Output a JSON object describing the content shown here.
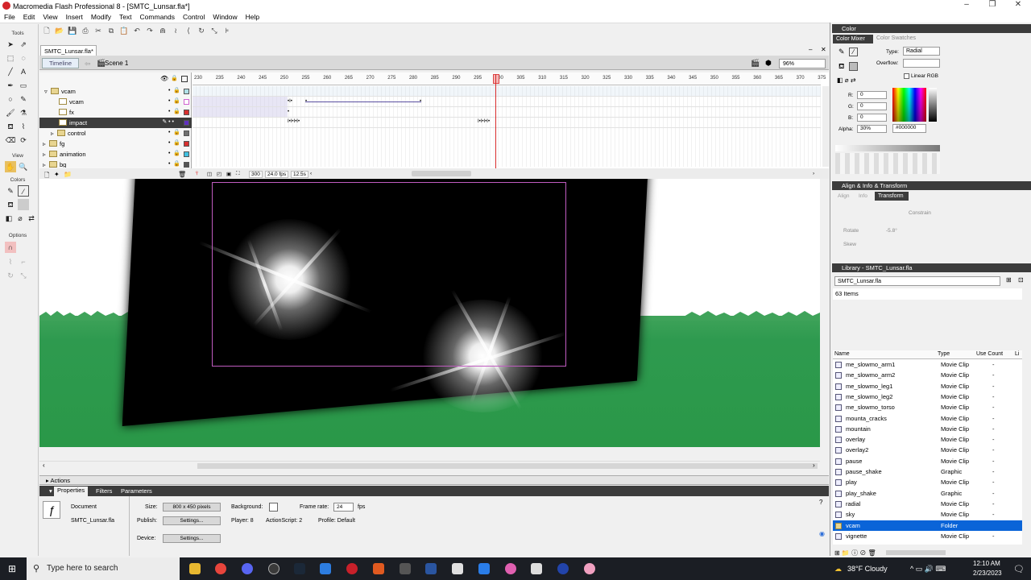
{
  "window": {
    "title": "Macromedia Flash Professional 8 - [SMTC_Lunsar.fla*]"
  },
  "menu": [
    "File",
    "Edit",
    "View",
    "Insert",
    "Modify",
    "Text",
    "Commands",
    "Control",
    "Window",
    "Help"
  ],
  "tools": {
    "label_tools": "Tools",
    "label_view": "View",
    "label_colors": "Colors",
    "label_options": "Options"
  },
  "document": {
    "tab": "SMTC_Lunsar.fla*",
    "timeline_btn": "Timeline",
    "scene": "Scene 1",
    "zoom": "96%"
  },
  "timeline": {
    "ruler": [
      "230",
      "235",
      "240",
      "245",
      "250",
      "255",
      "260",
      "265",
      "270",
      "275",
      "280",
      "285",
      "290",
      "295",
      "300",
      "305",
      "310",
      "315",
      "320",
      "325",
      "330",
      "335",
      "340",
      "345",
      "350",
      "355",
      "360",
      "365",
      "370",
      "375"
    ],
    "layers": [
      {
        "name": "vcam",
        "type": "folder",
        "color": "#b0e0e8"
      },
      {
        "name": "vcam",
        "type": "layer",
        "color": "#d060d0"
      },
      {
        "name": "fx",
        "type": "layer",
        "color": "#d83030"
      },
      {
        "name": "impact",
        "type": "layer",
        "color": "#6030c0"
      },
      {
        "name": "control",
        "type": "folder",
        "color": "#707070"
      },
      {
        "name": "fg",
        "type": "folder",
        "color": "#d83030"
      },
      {
        "name": "animation",
        "type": "folder",
        "color": "#40c0e0"
      },
      {
        "name": "bg",
        "type": "folder",
        "color": "#555555"
      }
    ],
    "frame": "300",
    "fps": "24.0 fps",
    "time": "12.5s"
  },
  "panels_bottom": {
    "actions": "Actions",
    "tabs": [
      "Properties",
      "Filters",
      "Parameters"
    ]
  },
  "properties": {
    "doc_label": "Document",
    "file": "SMTC_Lunsar.fla",
    "size_label": "Size:",
    "size": "800 x 450 pixels",
    "background_label": "Background:",
    "framerate_label": "Frame rate:",
    "framerate": "24",
    "fps": "fps",
    "publish_label": "Publish:",
    "settings": "Settings...",
    "player": "Player: 8",
    "actionscript": "ActionScript: 2",
    "profile": "Profile: Default",
    "device_label": "Device:"
  },
  "color": {
    "header": "Color",
    "tab1": "Color Mixer",
    "tab2": "Color Swatches",
    "type_label": "Type:",
    "type": "Radial",
    "overflow_label": "Overflow:",
    "linear_rgb": "Linear RGB",
    "r": "0",
    "g": "0",
    "b": "0",
    "alpha": "30%",
    "hex": "#000000"
  },
  "align": {
    "header": "Align & Info & Transform",
    "tabs": [
      "Align",
      "Info",
      "Transform"
    ],
    "constrain": "Constrain",
    "rotate": "Rotate",
    "rotate_val": "-5.8°",
    "skew": "Skew"
  },
  "library": {
    "header": "Library - SMTC_Lunsar.fla",
    "select": "SMTC_Lunsar.fla",
    "count": "63 Items",
    "columns": [
      "Name",
      "Type",
      "Use Count",
      "Li"
    ],
    "items": [
      {
        "name": "me_slowmo_arm1",
        "type": "Movie Clip",
        "count": "-"
      },
      {
        "name": "me_slowmo_arm2",
        "type": "Movie Clip",
        "count": "-"
      },
      {
        "name": "me_slowmo_leg1",
        "type": "Movie Clip",
        "count": "-"
      },
      {
        "name": "me_slowmo_leg2",
        "type": "Movie Clip",
        "count": "-"
      },
      {
        "name": "me_slowmo_torso",
        "type": "Movie Clip",
        "count": "-"
      },
      {
        "name": "mounta_cracks",
        "type": "Movie Clip",
        "count": "-"
      },
      {
        "name": "mountain",
        "type": "Movie Clip",
        "count": "-"
      },
      {
        "name": "overlay",
        "type": "Movie Clip",
        "count": "-"
      },
      {
        "name": "overlay2",
        "type": "Movie Clip",
        "count": "-"
      },
      {
        "name": "pause",
        "type": "Movie Clip",
        "count": "-"
      },
      {
        "name": "pause_shake",
        "type": "Graphic",
        "count": "-"
      },
      {
        "name": "play",
        "type": "Movie Clip",
        "count": "-"
      },
      {
        "name": "play_shake",
        "type": "Graphic",
        "count": "-"
      },
      {
        "name": "radial",
        "type": "Movie Clip",
        "count": "-"
      },
      {
        "name": "sky",
        "type": "Movie Clip",
        "count": "-"
      },
      {
        "name": "vcam",
        "type": "Folder",
        "count": ""
      },
      {
        "name": "vignette",
        "type": "Movie Clip",
        "count": "-"
      }
    ]
  },
  "taskbar": {
    "search": "Type here to search",
    "weather": "38°F  Cloudy",
    "time": "12:10 AM",
    "date": "2/23/2023"
  }
}
